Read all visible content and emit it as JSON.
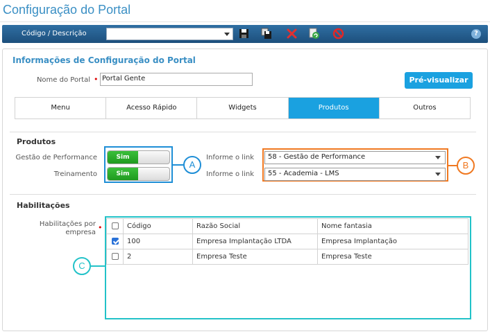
{
  "page_title": "Configuração do Portal",
  "toolbar": {
    "label": "Código / Descrição",
    "select_value": "",
    "icons": [
      "save-icon",
      "save-copy-icon",
      "delete-icon",
      "refresh-icon",
      "cancel-icon",
      "help-icon"
    ],
    "help_glyph": "?"
  },
  "section": {
    "title": "Informações de Configuração do Portal",
    "nome_label": "Nome do Portal",
    "nome_value": "Portal Gente",
    "preview_label": "Pré-visualizar"
  },
  "tabs": [
    {
      "label": "Menu",
      "active": false
    },
    {
      "label": "Acesso Rápido",
      "active": false
    },
    {
      "label": "Widgets",
      "active": false
    },
    {
      "label": "Produtos",
      "active": true
    },
    {
      "label": "Outros",
      "active": false
    }
  ],
  "produtos": {
    "title": "Produtos",
    "rows": [
      {
        "label": "Gestão de Performance",
        "toggle": "Sim",
        "link_label": "Informe o link",
        "link_value": "58 - Gestão de Performance"
      },
      {
        "label": "Treinamento",
        "toggle": "Sim",
        "link_label": "Informe o link",
        "link_value": "55 - Academia - LMS"
      }
    ]
  },
  "habilitacoes": {
    "title": "Habilitações",
    "label_line1": "Habilitações por",
    "label_line2": "empresa",
    "columns": [
      "Código",
      "Razão Social",
      "Nome fantasia"
    ],
    "rows": [
      {
        "checked": true,
        "codigo": "100",
        "razao": "Empresa Implantação LTDA",
        "fantasia": "Empresa Implantação"
      },
      {
        "checked": false,
        "codigo": "2",
        "razao": "Empresa Teste",
        "fantasia": "Empresa Teste"
      }
    ]
  },
  "callouts": {
    "a": "A",
    "b": "B",
    "c": "C"
  },
  "colors": {
    "accent": "#1aa1e0",
    "callout_a": "#1e8ed6",
    "callout_b": "#f07820",
    "callout_c": "#22c2c8",
    "toggle_on": "#2aae2a"
  }
}
